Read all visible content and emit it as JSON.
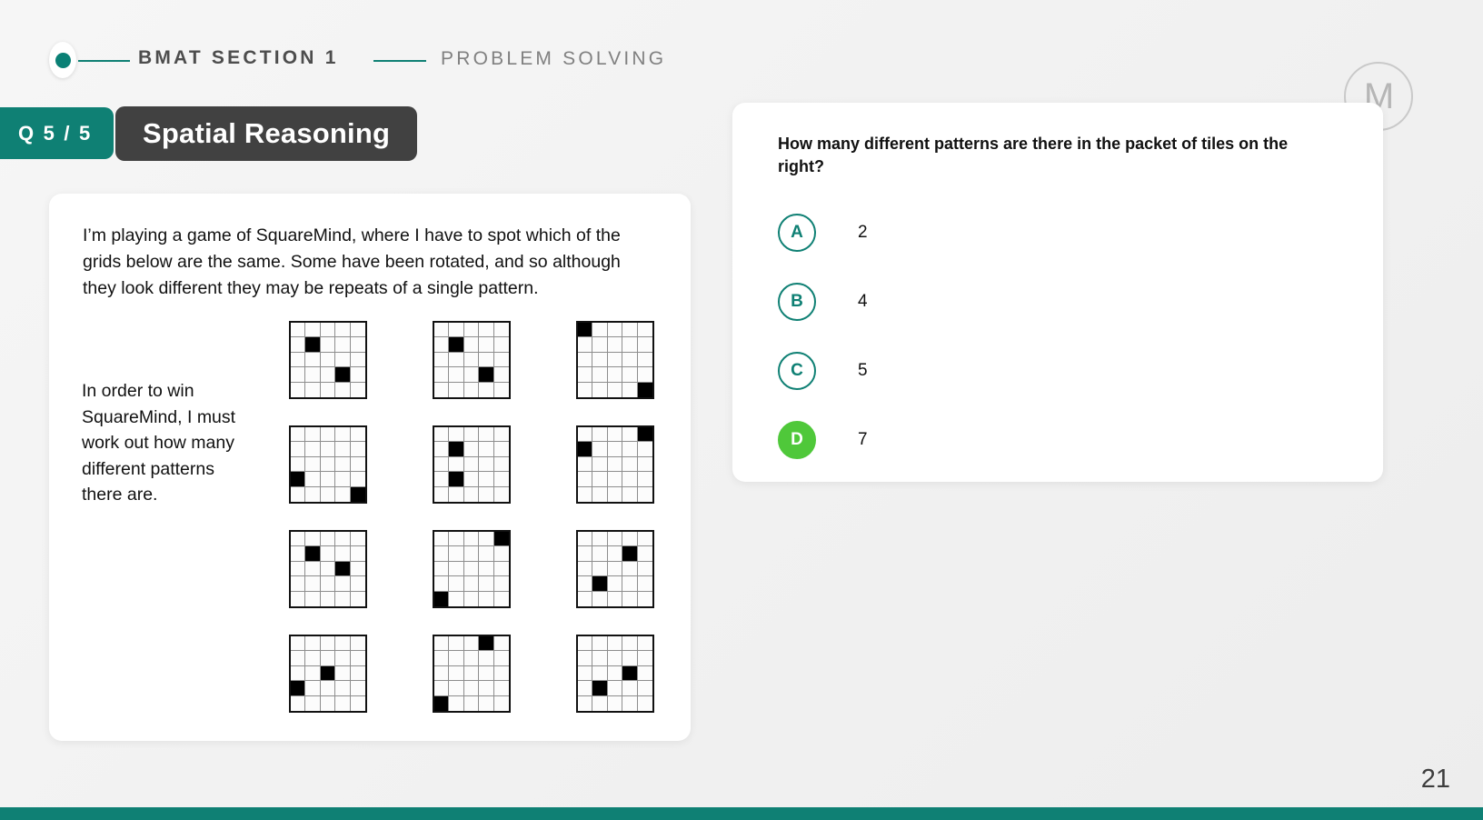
{
  "header": {
    "title": "BMAT SECTION 1",
    "subtitle": "PROBLEM SOLVING",
    "logo_letter": "M"
  },
  "badges": {
    "question_counter": "Q 5 / 5",
    "topic": "Spatial Reasoning"
  },
  "stimulus": {
    "paragraph_1": "I’m playing a game of SquareMind, where I have to spot which of the grids below are the same. Some have been rotated, and so although they look different they may be repeats of a single pattern.",
    "paragraph_2": "In order to win SquareMind, I must work out how many different patterns there are."
  },
  "tiles": {
    "rows": 4,
    "cols": 3,
    "grid_size": 5,
    "patterns": [
      {
        "id": "tile-1",
        "filled": [
          [
            1,
            1
          ],
          [
            3,
            3
          ]
        ]
      },
      {
        "id": "tile-2",
        "filled": [
          [
            1,
            1
          ],
          [
            3,
            3
          ]
        ]
      },
      {
        "id": "tile-3",
        "filled": [
          [
            0,
            0
          ],
          [
            4,
            4
          ]
        ]
      },
      {
        "id": "tile-4",
        "filled": [
          [
            3,
            0
          ],
          [
            4,
            4
          ]
        ]
      },
      {
        "id": "tile-5",
        "filled": [
          [
            1,
            1
          ],
          [
            3,
            1
          ]
        ]
      },
      {
        "id": "tile-6",
        "filled": [
          [
            0,
            4
          ],
          [
            1,
            0
          ]
        ]
      },
      {
        "id": "tile-7",
        "filled": [
          [
            1,
            1
          ],
          [
            2,
            3
          ]
        ]
      },
      {
        "id": "tile-8",
        "filled": [
          [
            0,
            4
          ],
          [
            4,
            0
          ]
        ]
      },
      {
        "id": "tile-9",
        "filled": [
          [
            1,
            3
          ],
          [
            3,
            1
          ]
        ]
      },
      {
        "id": "tile-10",
        "filled": [
          [
            2,
            2
          ],
          [
            3,
            0
          ]
        ]
      },
      {
        "id": "tile-11",
        "filled": [
          [
            0,
            3
          ],
          [
            4,
            0
          ]
        ]
      },
      {
        "id": "tile-12",
        "filled": [
          [
            2,
            3
          ],
          [
            3,
            1
          ]
        ]
      }
    ]
  },
  "question": {
    "stem": "How many different patterns are there in the packet of tiles on the right?",
    "options": [
      {
        "letter": "A",
        "text": "2",
        "selected": false
      },
      {
        "letter": "B",
        "text": "4",
        "selected": false
      },
      {
        "letter": "C",
        "text": "5",
        "selected": false
      },
      {
        "letter": "D",
        "text": "7",
        "selected": true
      }
    ]
  },
  "footer": {
    "page_number": "21"
  },
  "colors": {
    "teal": "#0f8074",
    "dark": "#414141",
    "selected_green": "#4fc83a",
    "page_bg": "#f4f4f4"
  }
}
